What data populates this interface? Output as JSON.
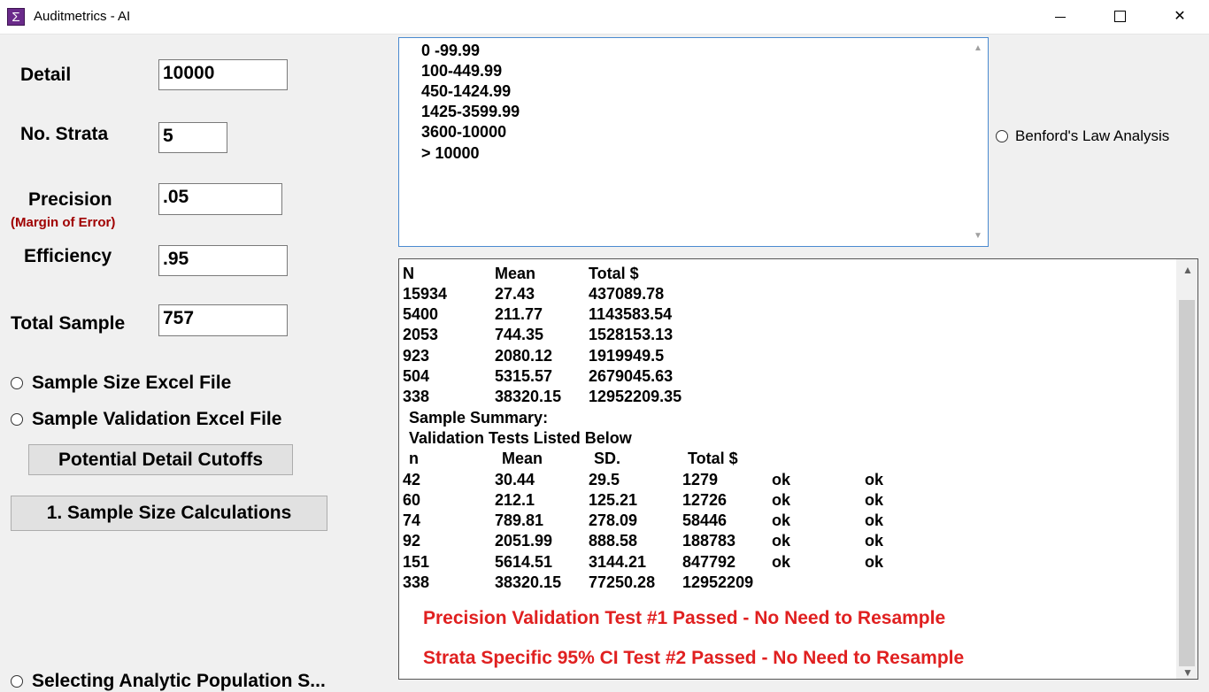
{
  "window": {
    "title": "Auditmetrics - AI",
    "icon_glyph": "Σ",
    "controls": {
      "minimize": "minimize-icon",
      "maximize": "maximize-icon",
      "close": "✕"
    }
  },
  "form": {
    "detail": {
      "label": "Detail",
      "value": "10000"
    },
    "strata": {
      "label": "No. Strata",
      "value": "5"
    },
    "precision": {
      "label": "Precision",
      "sublabel": "(Margin of Error)",
      "value": ".05"
    },
    "efficiency": {
      "label": "Efficiency",
      "value": ".95"
    },
    "total_sample": {
      "label": "Total Sample",
      "value": "757"
    },
    "radio_sample_size": "Sample Size Excel File",
    "radio_sample_validation": "Sample Validation Excel File",
    "btn_cutoffs": "Potential Detail Cutoffs",
    "btn_calc": "1. Sample Size Calculations",
    "radio_partial": "Selecting Analytic Population S..."
  },
  "strata_ranges": [
    "0 -99.99",
    "100-449.99",
    "450-1424.99",
    "1425-3599.99",
    "3600-10000",
    "> 10000"
  ],
  "benford": "Benford's Law Analysis",
  "output": {
    "pop_headers": [
      "N",
      "Mean",
      "Total $"
    ],
    "pop_rows": [
      [
        "15934",
        "27.43",
        "437089.78"
      ],
      [
        "5400",
        "211.77",
        "1143583.54"
      ],
      [
        "2053",
        "744.35",
        "1528153.13"
      ],
      [
        "923",
        "2080.12",
        "1919949.5"
      ],
      [
        "504",
        "5315.57",
        "2679045.63"
      ],
      [
        "338",
        "38320.15",
        "12952209.35"
      ]
    ],
    "summary_title": "Sample Summary:",
    "validation_title": "Validation Tests Listed Below",
    "sample_headers": [
      "n",
      "Mean",
      "SD.",
      "Total $"
    ],
    "sample_rows": [
      [
        "42",
        "30.44",
        "29.5",
        "1279",
        "ok",
        "ok"
      ],
      [
        "60",
        "212.1",
        "125.21",
        "12726",
        "ok",
        "ok"
      ],
      [
        "74",
        "789.81",
        "278.09",
        "58446",
        "ok",
        "ok"
      ],
      [
        "92",
        "2051.99",
        "888.58",
        "188783",
        "ok",
        "ok"
      ],
      [
        "151",
        "5614.51",
        "3144.21",
        "847792",
        "ok",
        "ok"
      ],
      [
        "338",
        "38320.15",
        "77250.28",
        "12952209",
        "",
        ""
      ]
    ],
    "result1": "Precision Validation Test #1 Passed - No Need to Resample",
    "result2": "Strata Specific 95% CI Test #2 Passed - No Need to Resample"
  },
  "colors": {
    "result_red": "#e02020",
    "sublabel_red": "#a00000",
    "app_icon": "#6a2a8a",
    "textarea_border": "#4a8ad0"
  }
}
